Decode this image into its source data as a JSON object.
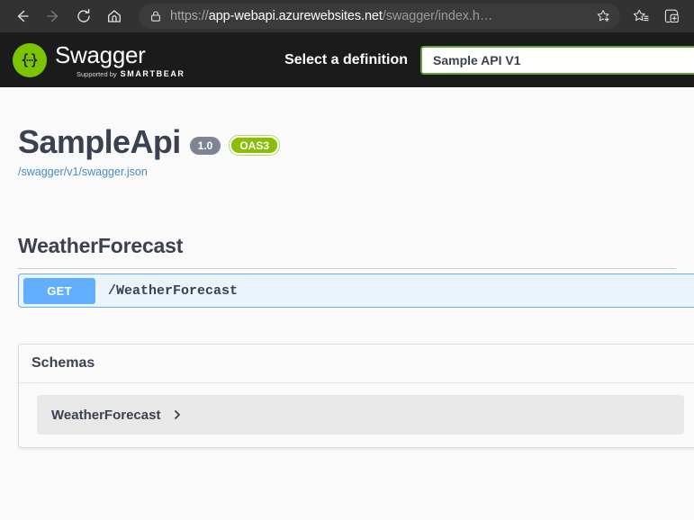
{
  "browser": {
    "back_label": "Back",
    "forward_label": "Forward",
    "refresh_label": "Refresh",
    "home_label": "Home",
    "url": {
      "scheme": "https://",
      "host": "app-webapi.azurewebsites.net",
      "path": "/swagger/index.h…",
      "full": "https://app-webapi.azurewebsites.net/swagger/index.h…"
    },
    "icons": {
      "lock": "lock-icon",
      "add_favorite": "star-plus-icon",
      "favorites": "favorites-list-icon",
      "collections": "collections-icon"
    }
  },
  "topbar": {
    "logo_word": "Swagger",
    "logo_supported_by": "Supported by",
    "logo_brand": "SMARTBEAR",
    "definition_label": "Select a definition",
    "definition_value": "Sample API V1",
    "accent_green": "#7ac400",
    "select_border": "#62a03f"
  },
  "info": {
    "title": "SampleApi",
    "version_badge": "1.0",
    "spec_badge": "OAS3",
    "spec_url": "/swagger/v1/swagger.json",
    "version_badge_color": "#7d8492",
    "spec_badge_color": "#89bf04"
  },
  "tags": [
    {
      "name": "WeatherForecast",
      "operations": [
        {
          "method": "GET",
          "path": "/WeatherForecast",
          "method_color": "#61affe",
          "block_bg": "#ebf3fb"
        }
      ]
    }
  ],
  "schemas": {
    "heading": "Schemas",
    "models": [
      {
        "name": "WeatherForecast",
        "expanded": false,
        "chevron": "chevron-right-icon"
      }
    ]
  }
}
